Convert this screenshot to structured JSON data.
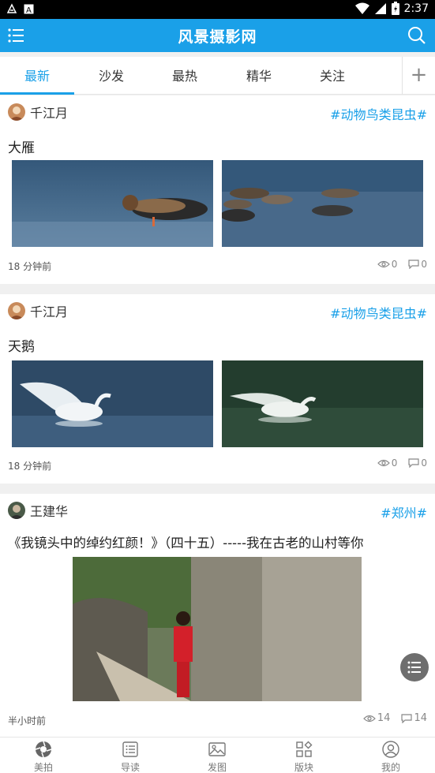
{
  "status_bar": {
    "time": "2:37"
  },
  "app": {
    "title": "风景摄影网"
  },
  "tabs": [
    {
      "label": "最新",
      "active": true
    },
    {
      "label": "沙发"
    },
    {
      "label": "最热"
    },
    {
      "label": "精华"
    },
    {
      "label": "关注"
    }
  ],
  "tab_add_label": "+",
  "posts": [
    {
      "author": "千江月",
      "tag": "#动物鸟类昆虫#",
      "title": "大雁",
      "time": "18 分钟前",
      "views": "0",
      "comments": "0"
    },
    {
      "author": "千江月",
      "tag": "#动物鸟类昆虫#",
      "title": "天鹅",
      "time": "18 分钟前",
      "views": "0",
      "comments": "0"
    },
    {
      "author": "王建华",
      "tag": "#郑州#",
      "title": "《我镜头中的绰约红颜！》（四十五）-----我在古老的山村等你",
      "time": "半小时前",
      "views": "14",
      "comments": "14"
    }
  ],
  "bottom_nav": [
    {
      "label": "美拍",
      "icon": "aperture-icon"
    },
    {
      "label": "导读",
      "icon": "list-icon"
    },
    {
      "label": "发图",
      "icon": "image-icon"
    },
    {
      "label": "版块",
      "icon": "grid-icon"
    },
    {
      "label": "我的",
      "icon": "user-icon"
    }
  ],
  "colors": {
    "accent": "#1aa0e8",
    "status_bar": "#000000",
    "background": "#f0f0f0"
  }
}
